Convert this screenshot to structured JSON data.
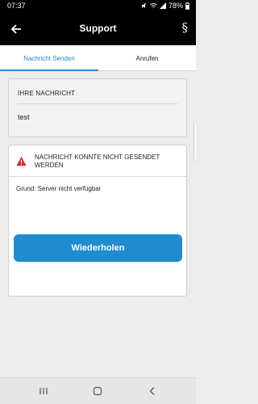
{
  "status_bar": {
    "time": "07:37",
    "battery": "78%"
  },
  "app_bar": {
    "title": "Support",
    "back_icon": "arrow-left-icon",
    "legal_label": "§"
  },
  "tabs": [
    {
      "label": "Nachricht Senden",
      "active": true
    },
    {
      "label": "Anrufen",
      "active": false
    }
  ],
  "message_card": {
    "label": "IHRE NACHRICHT",
    "value": "test"
  },
  "error_card": {
    "icon": "warning-icon",
    "title": "NACHRICHT KONNTE NICHT GESENDET WERDEN",
    "reason": "Grund: Server nicht verfügbar",
    "retry_label": "Wiederholen"
  },
  "colors": {
    "accent": "#1f8ccf",
    "tab_active": "#2c86c7",
    "error": "#d8262e",
    "top_bar": "#000000"
  },
  "system_nav": {
    "recents_icon": "recents-icon",
    "home_icon": "home-icon",
    "back_icon": "nav-back-icon"
  }
}
